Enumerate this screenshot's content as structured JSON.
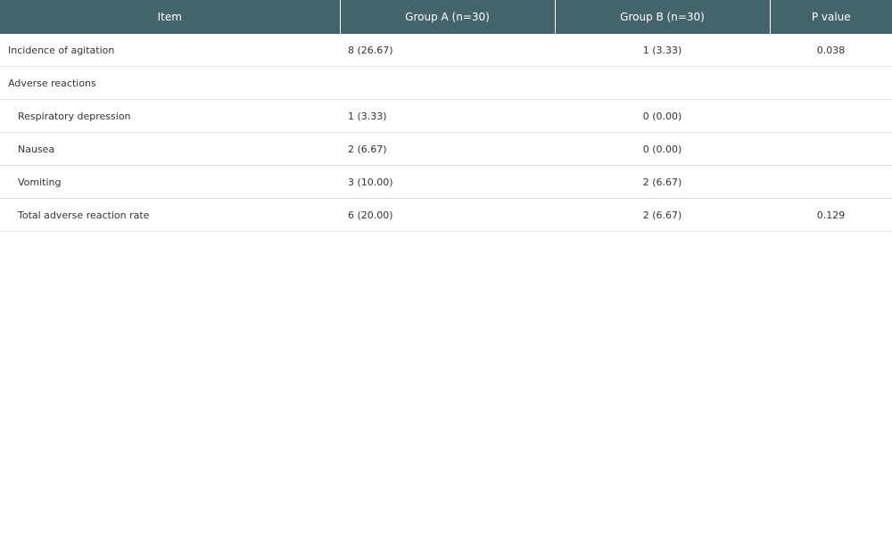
{
  "table": {
    "headers": {
      "item": "Item",
      "group_a": "Group A (n=30)",
      "group_b": "Group B (n=30)",
      "p_value": "P value"
    },
    "rows": [
      {
        "item": "Incidence of agitation",
        "group_a": "8 (26.67)",
        "group_b": "1 (3.33)",
        "p_value": "0.038"
      },
      {
        "item": "Adverse reactions",
        "group_a": "",
        "group_b": "",
        "p_value": ""
      },
      {
        "item": "Respiratory depression",
        "group_a": "1 (3.33)",
        "group_b": "0 (0.00)",
        "p_value": ""
      },
      {
        "item": "Nausea",
        "group_a": "2 (6.67)",
        "group_b": "0 (0.00)",
        "p_value": ""
      },
      {
        "item": "Vomiting",
        "group_a": "3 (10.00)",
        "group_b": "2 (6.67)",
        "p_value": ""
      },
      {
        "item": "Total adverse reaction rate",
        "group_a": "6 (20.00)",
        "group_b": "2 (6.67)",
        "p_value": "0.129"
      }
    ]
  },
  "colors": {
    "header_background": "#44646c",
    "header_text": "#ffffff",
    "row_divider": "#e3e3e3"
  }
}
